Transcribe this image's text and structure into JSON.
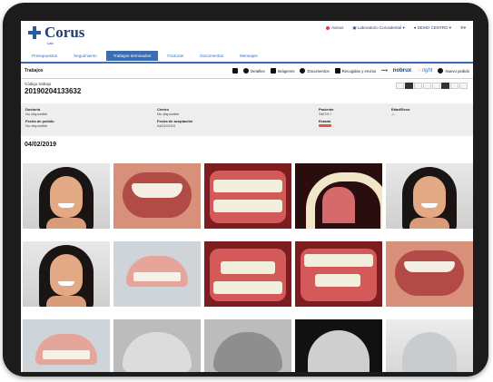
{
  "brand": {
    "name": "Corus",
    "sub": "Lab"
  },
  "top_links": [
    {
      "label": "Avisos",
      "icon": "bell-icon"
    },
    {
      "label": "Laboratorio Corusdental",
      "icon": "building-icon"
    },
    {
      "label": "DEMO CENTRO",
      "icon": "user-icon"
    },
    {
      "label": "",
      "icon": "gear-icon"
    }
  ],
  "nav": {
    "tabs": [
      {
        "label": "Presupuestos",
        "active": false
      },
      {
        "label": "Seguimiento",
        "active": false
      },
      {
        "label": "Trabajos terminados",
        "active": true
      },
      {
        "label": "Facturas",
        "active": false
      },
      {
        "label": "Documentos",
        "active": false
      },
      {
        "label": "Mensajes",
        "active": false
      }
    ]
  },
  "toolbar": {
    "title": "Trabajos",
    "items": [
      {
        "label": "",
        "icon": "truck-icon"
      },
      {
        "label": "Detalles",
        "icon": "info-icon"
      },
      {
        "label": "Imágenes",
        "icon": "camera-icon"
      },
      {
        "label": "Documentos",
        "icon": "document-icon"
      },
      {
        "label": "Recogidas y envíos",
        "icon": "truck-icon"
      },
      {
        "label": "",
        "icon": "more-icon"
      }
    ],
    "brand_a": "nobrux",
    "brand_b": "right",
    "new_order": "Nuevo pedido"
  },
  "work": {
    "code_label": "Código trabajo",
    "code_value": "20190204133632"
  },
  "details": {
    "doctor_label": "Doctor/a",
    "doctor_value": "No disponible",
    "order_date_label": "Fecha de pedido",
    "order_date_value": "No disponible",
    "center_label": "Centro",
    "center_value": "No disponible",
    "accept_date_label": "Fecha de aceptación",
    "accept_date_value": "04/02/2019",
    "patient_label": "Paciente",
    "patient_value": "SMTH I",
    "status_label": "Estado",
    "age_label": "Edad/Sexo",
    "age_value": "-/-"
  },
  "gallery": {
    "date": "04/02/2019"
  },
  "colors": {
    "accent": "#3a6db4",
    "brand": "#1f3f72",
    "status": "#d85a4a"
  }
}
